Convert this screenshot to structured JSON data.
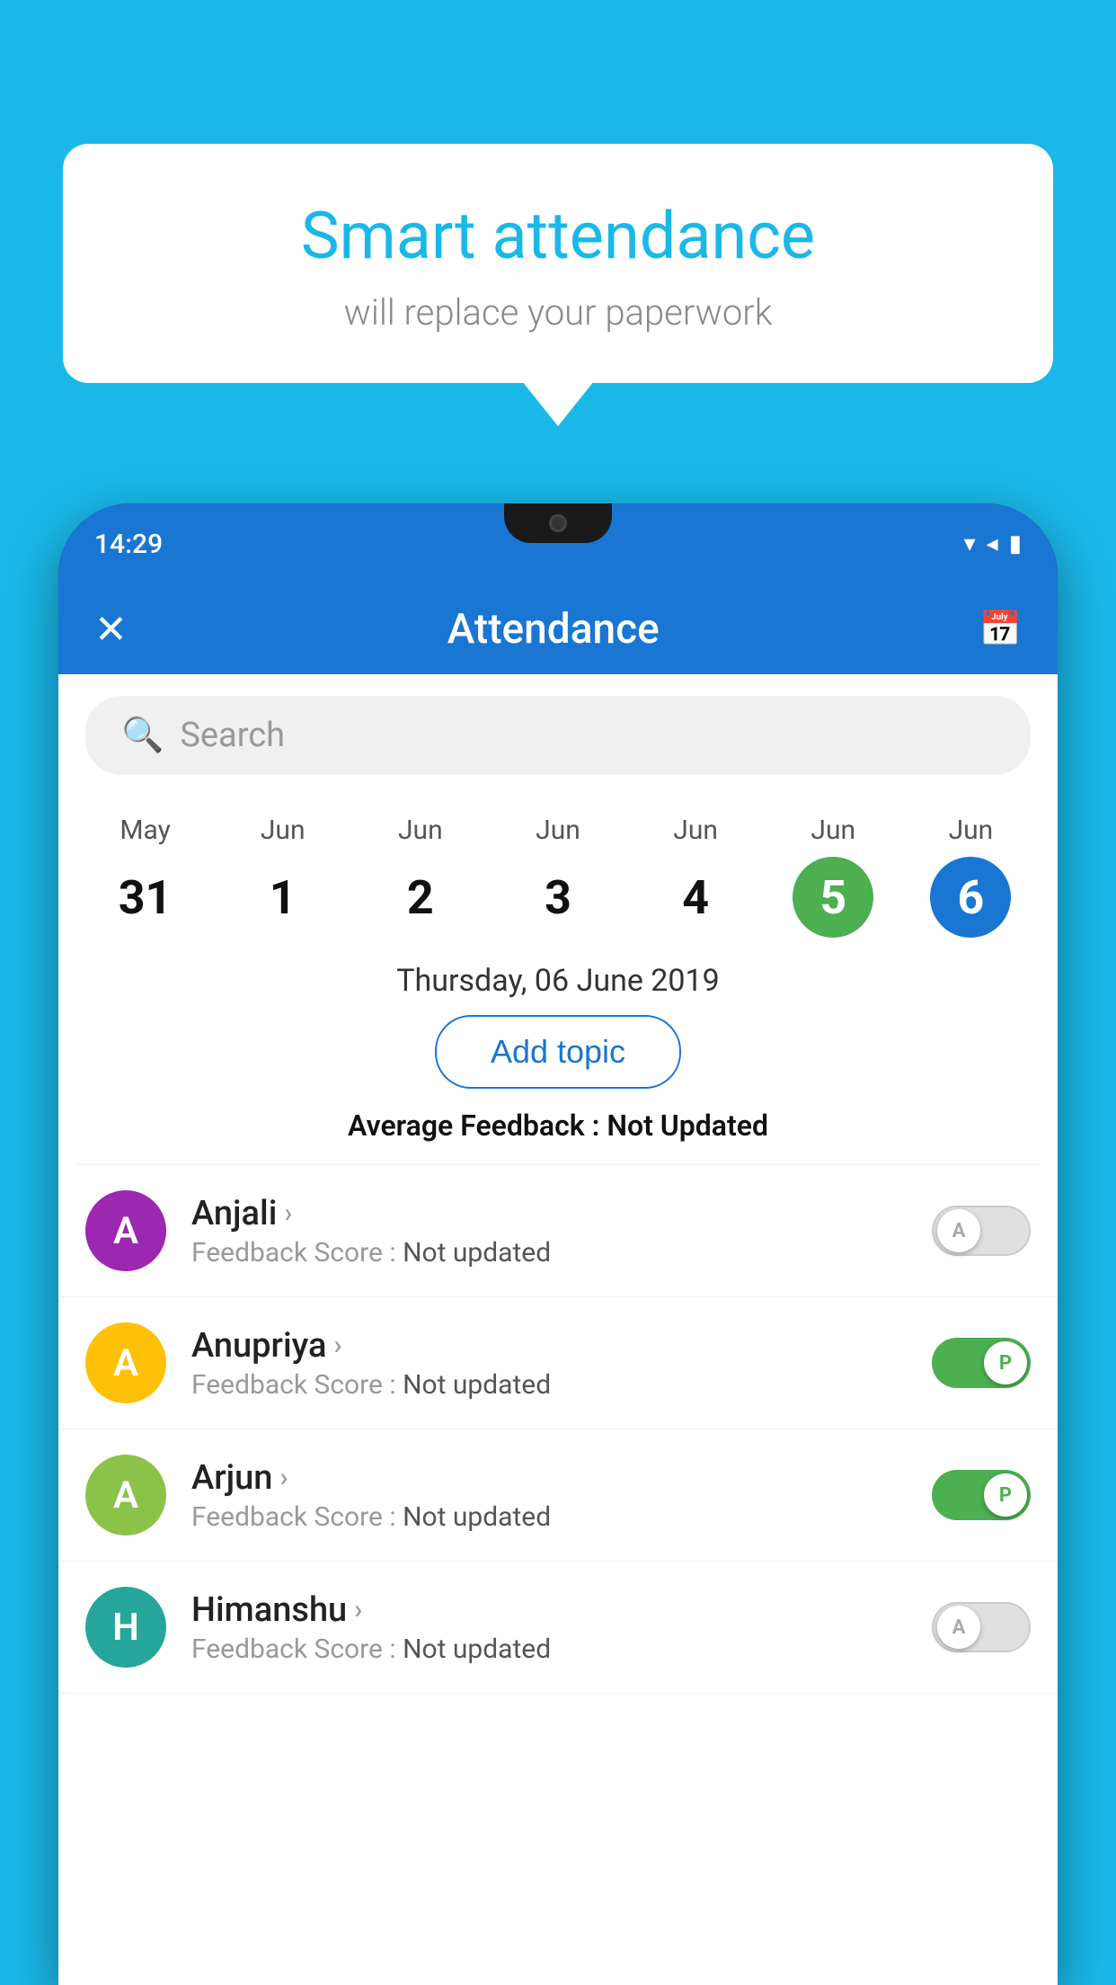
{
  "background": {
    "color": "#1ab8e8"
  },
  "speech_bubble": {
    "title": "Smart attendance",
    "subtitle": "will replace your paperwork"
  },
  "phone": {
    "status_bar": {
      "time": "14:29",
      "icons": "▼ ◀ ▮"
    },
    "header": {
      "close_icon": "✕",
      "title": "Attendance",
      "calendar_icon": "📅"
    },
    "search": {
      "placeholder": "Search"
    },
    "dates": [
      {
        "month": "May",
        "day": "31",
        "style": "normal"
      },
      {
        "month": "Jun",
        "day": "1",
        "style": "normal"
      },
      {
        "month": "Jun",
        "day": "2",
        "style": "normal"
      },
      {
        "month": "Jun",
        "day": "3",
        "style": "normal"
      },
      {
        "month": "Jun",
        "day": "4",
        "style": "normal"
      },
      {
        "month": "Jun",
        "day": "5",
        "style": "green"
      },
      {
        "month": "Jun",
        "day": "6",
        "style": "blue"
      }
    ],
    "selected_date": "Thursday, 06 June 2019",
    "add_topic_label": "Add topic",
    "average_feedback_label": "Average Feedback : ",
    "average_feedback_value": "Not Updated",
    "students": [
      {
        "name": "Anjali",
        "avatar_letter": "A",
        "avatar_color": "av-purple",
        "feedback_label": "Feedback Score : ",
        "feedback_value": "Not updated",
        "toggle": "off",
        "toggle_letter": "A"
      },
      {
        "name": "Anupriya",
        "avatar_letter": "A",
        "avatar_color": "av-yellow",
        "feedback_label": "Feedback Score : ",
        "feedback_value": "Not updated",
        "toggle": "on",
        "toggle_letter": "P"
      },
      {
        "name": "Arjun",
        "avatar_letter": "A",
        "avatar_color": "av-green-light",
        "feedback_label": "Feedback Score : ",
        "feedback_value": "Not updated",
        "toggle": "on",
        "toggle_letter": "P"
      },
      {
        "name": "Himanshu",
        "avatar_letter": "H",
        "avatar_color": "av-teal",
        "feedback_label": "Feedback Score : ",
        "feedback_value": "Not updated",
        "toggle": "off",
        "toggle_letter": "A"
      }
    ]
  }
}
